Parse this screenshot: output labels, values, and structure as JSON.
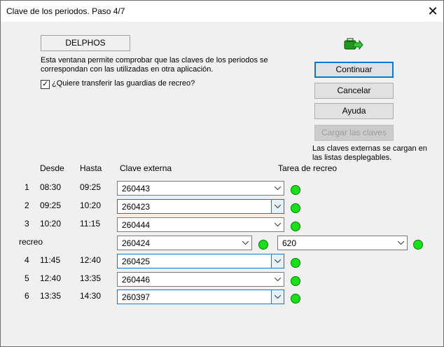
{
  "window": {
    "title": "Clave de los periodos. Paso 4/7",
    "close": "✕"
  },
  "app_name": "DELPHOS",
  "description": "Esta ventana permite comprobar que las claves de los periodos se correspondan con las utilizadas en otra aplicación.",
  "checkbox": {
    "label": "¿Quiere transferir las guardias de recreo?",
    "checked": true,
    "mark": "✓"
  },
  "buttons": {
    "continue": "Continuar",
    "cancel": "Cancelar",
    "help": "Ayuda",
    "load": "Cargar las claves"
  },
  "note": "Las claves externas se cargan en las listas desplegables.",
  "headers": {
    "from": "Desde",
    "to": "Hasta",
    "external": "Clave externa",
    "break_task": "Tarea de recreo"
  },
  "rows": [
    {
      "num": "1",
      "from": "08:30",
      "to": "09:25",
      "key": "260443"
    },
    {
      "num": "2",
      "from": "09:25",
      "to": "10:20",
      "key": "260423"
    },
    {
      "num": "3",
      "from": "10:20",
      "to": "11:15",
      "key": "260444"
    },
    {
      "label": "recreo",
      "key": "260424",
      "task": "620"
    },
    {
      "num": "4",
      "from": "11:45",
      "to": "12:40",
      "key": "260425"
    },
    {
      "num": "5",
      "from": "12:40",
      "to": "13:35",
      "key": "260446"
    },
    {
      "num": "6",
      "from": "13:35",
      "to": "14:30",
      "key": "260397"
    }
  ],
  "colors": {
    "status_ok": "#19e019",
    "focus": "#0078d7"
  }
}
